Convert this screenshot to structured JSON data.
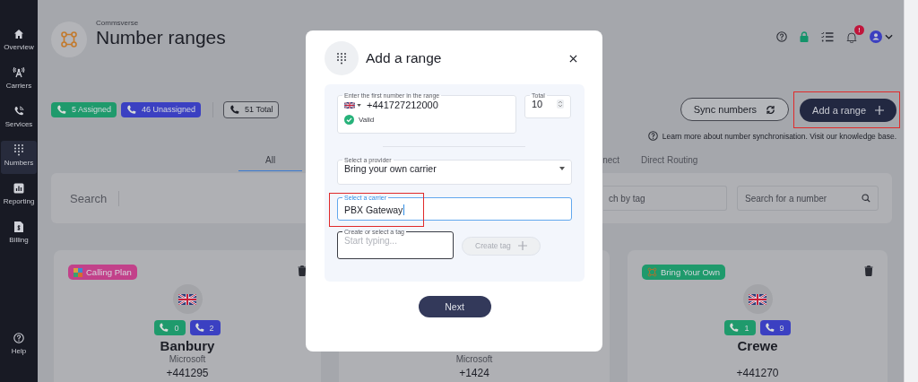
{
  "sidebar": {
    "items": [
      {
        "label": "Overview",
        "selected": false
      },
      {
        "label": "Carriers",
        "selected": false
      },
      {
        "label": "Services",
        "selected": false
      },
      {
        "label": "Numbers",
        "selected": true
      },
      {
        "label": "Reporting",
        "selected": false
      },
      {
        "label": "Billing",
        "selected": false
      }
    ],
    "help_item": {
      "label": "Help"
    }
  },
  "header": {
    "brand": "Commsverse",
    "title": "Number ranges",
    "notification_badge": "!"
  },
  "stats": [
    {
      "label": "5 Assigned",
      "kind": "filled",
      "color": "#1f9a6c"
    },
    {
      "label": "46 Unassigned",
      "kind": "filled",
      "color": "#3b40c2"
    },
    {
      "label": "51 Total",
      "kind": "outline"
    }
  ],
  "actions": [
    {
      "label": "Sync numbers",
      "kind": "secondary",
      "highlighted": false
    },
    {
      "label": "Add a range",
      "kind": "primary",
      "highlighted": true
    }
  ],
  "help_text": "Learn more about number synchronisation. Visit our knowledge base.",
  "tabs": [
    {
      "label": "All",
      "selected": true
    },
    {
      "label": "nect",
      "selected": false
    },
    {
      "label": "Direct Routing",
      "selected": false
    }
  ],
  "filters": {
    "search_label": "Search",
    "tag_search": {
      "placeholder": "ch by tag"
    },
    "number_search": {
      "placeholder": "Search for a number"
    }
  },
  "cards": [
    {
      "tag": {
        "label": "Calling Plan",
        "kind": "calling-plan",
        "color": "#c2418a"
      },
      "assigned": "0",
      "unassigned": "2",
      "name": "Banbury",
      "provider": "Microsoft",
      "number": "+441295"
    },
    {
      "provider": "Microsoft",
      "number": "+1424"
    },
    {
      "tag": {
        "label": "Bring Your Own",
        "kind": "byo",
        "color": "#1f9a6c"
      },
      "assigned": "1",
      "unassigned": "9",
      "name": "Crewe",
      "number": "+441270"
    }
  ],
  "dialog": {
    "title": "Add a range",
    "first_number": {
      "label": "Enter the first number in the range",
      "value": "+441727212000",
      "status": "Valid"
    },
    "total": {
      "label": "Total",
      "value": "10"
    },
    "provider": {
      "label": "Select a provider",
      "value": "Bring your own carrier"
    },
    "carrier": {
      "label": "Select a carrier",
      "value": "PBX Gateway",
      "focused": true,
      "highlighted": true
    },
    "tag": {
      "label": "Create or select a tag",
      "placeholder": "Start typing..."
    },
    "create_tag": {
      "label": "Create tag",
      "disabled": true
    },
    "next": {
      "label": "Next"
    }
  }
}
